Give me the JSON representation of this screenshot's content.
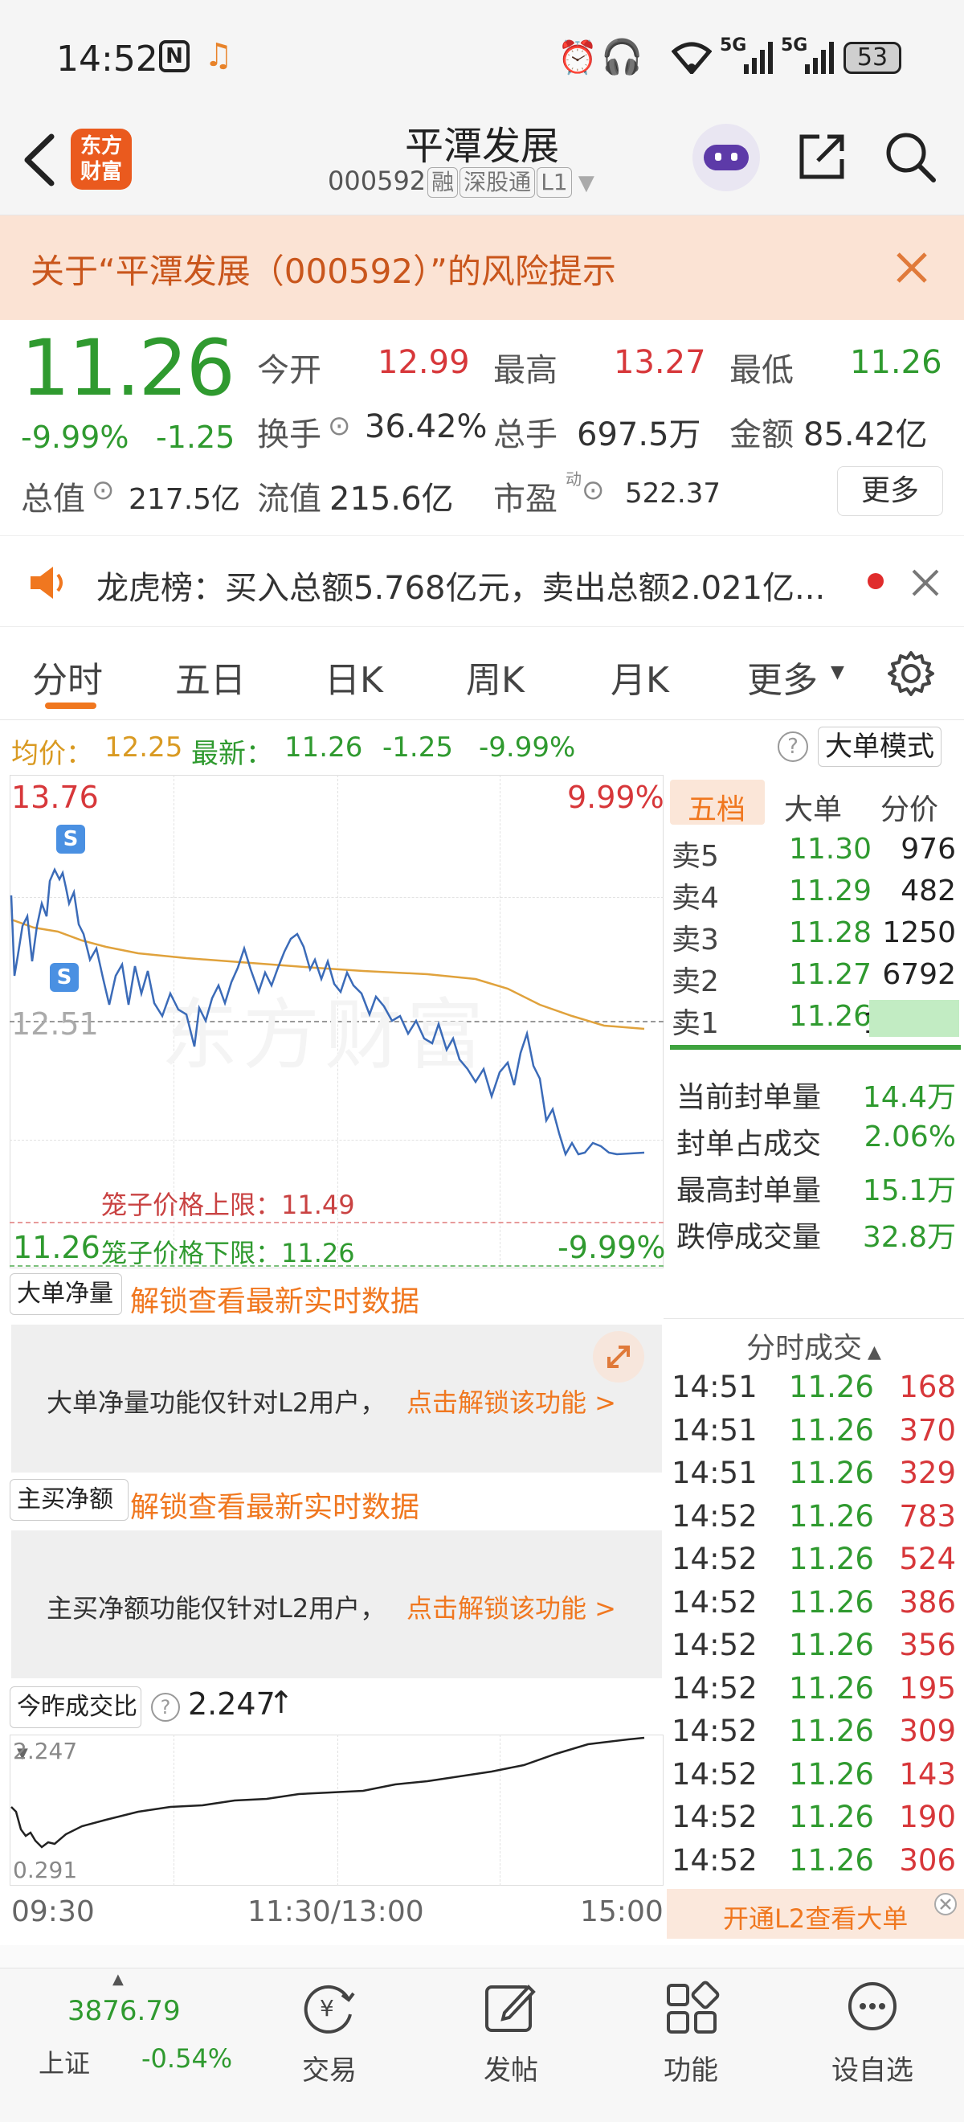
{
  "status": {
    "time": "14:52",
    "battery": "53",
    "net1": "5G",
    "net2": "5G"
  },
  "header": {
    "logo_line1": "东方",
    "logo_line2": "财富",
    "stock_name": "平潭发展",
    "code": "000592",
    "badges": [
      "融",
      "深股通",
      "L1"
    ]
  },
  "risk": {
    "text": "关于“平潭发展（000592）”的风险提示"
  },
  "quote": {
    "price": "11.26",
    "pct": "-9.99%",
    "chg": "-1.25",
    "open_label": "今开",
    "open": "12.99",
    "high_label": "最高",
    "high": "13.27",
    "low_label": "最低",
    "low": "11.26",
    "turnover_label": "换手",
    "turnover": "36.42%",
    "volume_label": "总手",
    "volume": "697.5万",
    "amount_label": "金额",
    "amount": "85.42亿",
    "mktcap_label": "总值",
    "mktcap": "217.5亿",
    "float_label": "流值",
    "float": "215.6亿",
    "pe_label": "市盈",
    "pe_sup": "动",
    "pe": "522.37",
    "more": "更多"
  },
  "dragon": {
    "text": "龙虎榜：买入总额5.768亿元，卖出总额2.021亿..."
  },
  "tabs": [
    "分时",
    "五日",
    "日K",
    "周K",
    "月K",
    "更多"
  ],
  "infobar": {
    "avg_label": "均价：",
    "avg": "12.25",
    "latest_label": "最新：",
    "latest": "11.26",
    "chg": "-1.25",
    "pct": "-9.99%",
    "mode": "大单模式"
  },
  "chart": {
    "top_price": "13.76",
    "top_pct": "9.99%",
    "mid_price": "12.51",
    "bottom_price": "11.26",
    "bottom_pct": "-9.99%",
    "cage_upper": "笼子价格上限：11.49",
    "cage_lower": "笼子价格下限：11.26",
    "watermark": "东方财富"
  },
  "book": {
    "tabs": [
      "五档",
      "大单",
      "分价"
    ],
    "rows": [
      {
        "label": "卖5",
        "price": "11.30",
        "vol": "976"
      },
      {
        "label": "卖4",
        "price": "11.29",
        "vol": "482"
      },
      {
        "label": "卖3",
        "price": "11.28",
        "vol": "1250"
      },
      {
        "label": "卖2",
        "price": "11.27",
        "vol": "6792"
      },
      {
        "label": "卖1",
        "price": "11.26",
        "vol": "14.4万"
      }
    ],
    "stats": [
      {
        "label": "当前封单量",
        "value": "14.4万"
      },
      {
        "label": "封单占成交",
        "value": "2.06%"
      },
      {
        "label": "最高封单量",
        "value": "15.1万"
      },
      {
        "label": "跌停成交量",
        "value": "32.8万"
      }
    ]
  },
  "panel1": {
    "select": "大单净量",
    "unlock": "解锁查看最新实时数据",
    "msg": "大单净量功能仅针对L2用户，",
    "link": "点击解锁该功能 >"
  },
  "panel2": {
    "select": "主买净额",
    "unlock": "解锁查看最新实时数据",
    "msg": "主买净额功能仅针对L2用户，",
    "link": "点击解锁该功能 >"
  },
  "panel3": {
    "select": "今昨成交比",
    "value": "2.247",
    "top": "2.247",
    "bottom": "0.291"
  },
  "xaxis": [
    "09:30",
    "11:30/13:00",
    "15:00"
  ],
  "ticks": {
    "title": "分时成交",
    "rows": [
      {
        "t": "14:51",
        "p": "11.26",
        "v": "168"
      },
      {
        "t": "14:51",
        "p": "11.26",
        "v": "370"
      },
      {
        "t": "14:51",
        "p": "11.26",
        "v": "329"
      },
      {
        "t": "14:52",
        "p": "11.26",
        "v": "783"
      },
      {
        "t": "14:52",
        "p": "11.26",
        "v": "524"
      },
      {
        "t": "14:52",
        "p": "11.26",
        "v": "386"
      },
      {
        "t": "14:52",
        "p": "11.26",
        "v": "356"
      },
      {
        "t": "14:52",
        "p": "11.26",
        "v": "195"
      },
      {
        "t": "14:52",
        "p": "11.26",
        "v": "309"
      },
      {
        "t": "14:52",
        "p": "11.26",
        "v": "143"
      },
      {
        "t": "14:52",
        "p": "11.26",
        "v": "190"
      },
      {
        "t": "14:52",
        "p": "11.26",
        "v": "306"
      }
    ],
    "l2": "开通L2查看大单"
  },
  "nav": {
    "index_value": "3876.79",
    "index_name": "上证",
    "index_pct": "-0.54%",
    "items": [
      "交易",
      "发帖",
      "功能",
      "设自选"
    ]
  }
}
